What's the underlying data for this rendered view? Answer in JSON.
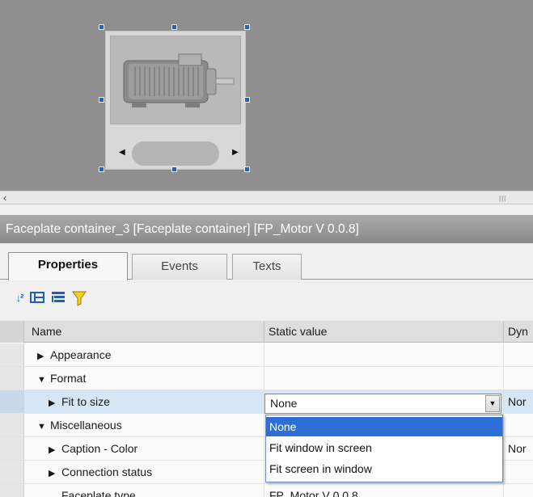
{
  "object_title": "Faceplate container_3 [Faceplate container] [FP_Motor V 0.0.8]",
  "tabs": [
    {
      "label": "Properties",
      "active": true
    },
    {
      "label": "Events",
      "active": false
    },
    {
      "label": "Texts",
      "active": false
    }
  ],
  "toolbar": {
    "sort_icon": "sort-az-icon",
    "categorize_icon": "categorize-icon",
    "hierarchy_icon": "hierarchy-icon",
    "filter_icon": "filter-icon"
  },
  "columns": {
    "name": "Name",
    "static": "Static value",
    "dynamic": "Dyn"
  },
  "rows": [
    {
      "label": "Appearance",
      "expanded": false,
      "level": 1,
      "value": "",
      "dyn": ""
    },
    {
      "label": "Format",
      "expanded": true,
      "level": 1,
      "value": "",
      "dyn": ""
    },
    {
      "label": "Fit to size",
      "expanded": false,
      "level": 2,
      "value": "None",
      "dyn": "Nor"
    },
    {
      "label": "Miscellaneous",
      "expanded": true,
      "level": 1,
      "value": "",
      "dyn": ""
    },
    {
      "label": "Caption - Color",
      "expanded": false,
      "level": 2,
      "value": "",
      "dyn": "Nor"
    },
    {
      "label": "Connection status",
      "expanded": false,
      "level": 2,
      "value": "",
      "dyn": ""
    },
    {
      "label": "Faceplate type",
      "expanded": false,
      "level": 2,
      "value": "FP_Motor V 0.0.8",
      "dyn": ""
    }
  ],
  "fit_to_size_combo": {
    "value": "None",
    "options": [
      "None",
      "Fit window in screen",
      "Fit screen in window"
    ],
    "highlighted": "None"
  },
  "colors": {
    "canvas": "#8f8f8f",
    "selection_handle": "#1464d6",
    "highlight": "#2e6fd6"
  }
}
